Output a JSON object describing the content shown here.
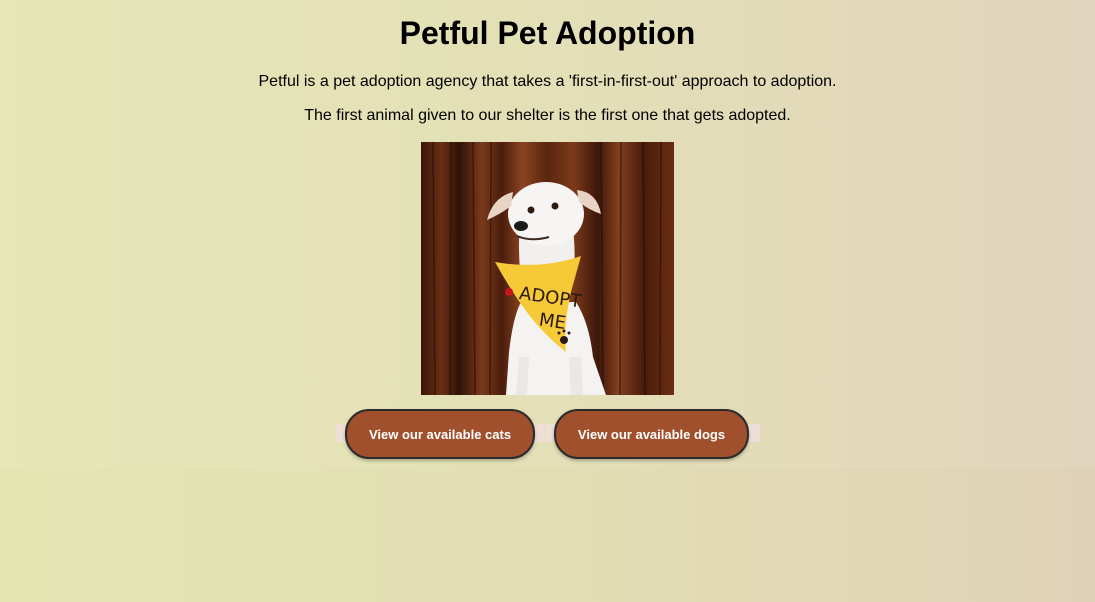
{
  "page": {
    "title": "Petful Pet Adoption",
    "description_1": "Petful is a pet adoption agency that takes a 'first-in-first-out' approach to adoption.",
    "description_2": "The first animal given to our shelter is the first one that gets adopted."
  },
  "hero_image": {
    "subject": "white dog wearing yellow bandana",
    "bandana_text": "ADOPT ME",
    "bandana_color": "#f6c937"
  },
  "actions": {
    "cats_label": "View our available cats",
    "dogs_label": "View our available dogs",
    "button_color": "#a0502c"
  }
}
